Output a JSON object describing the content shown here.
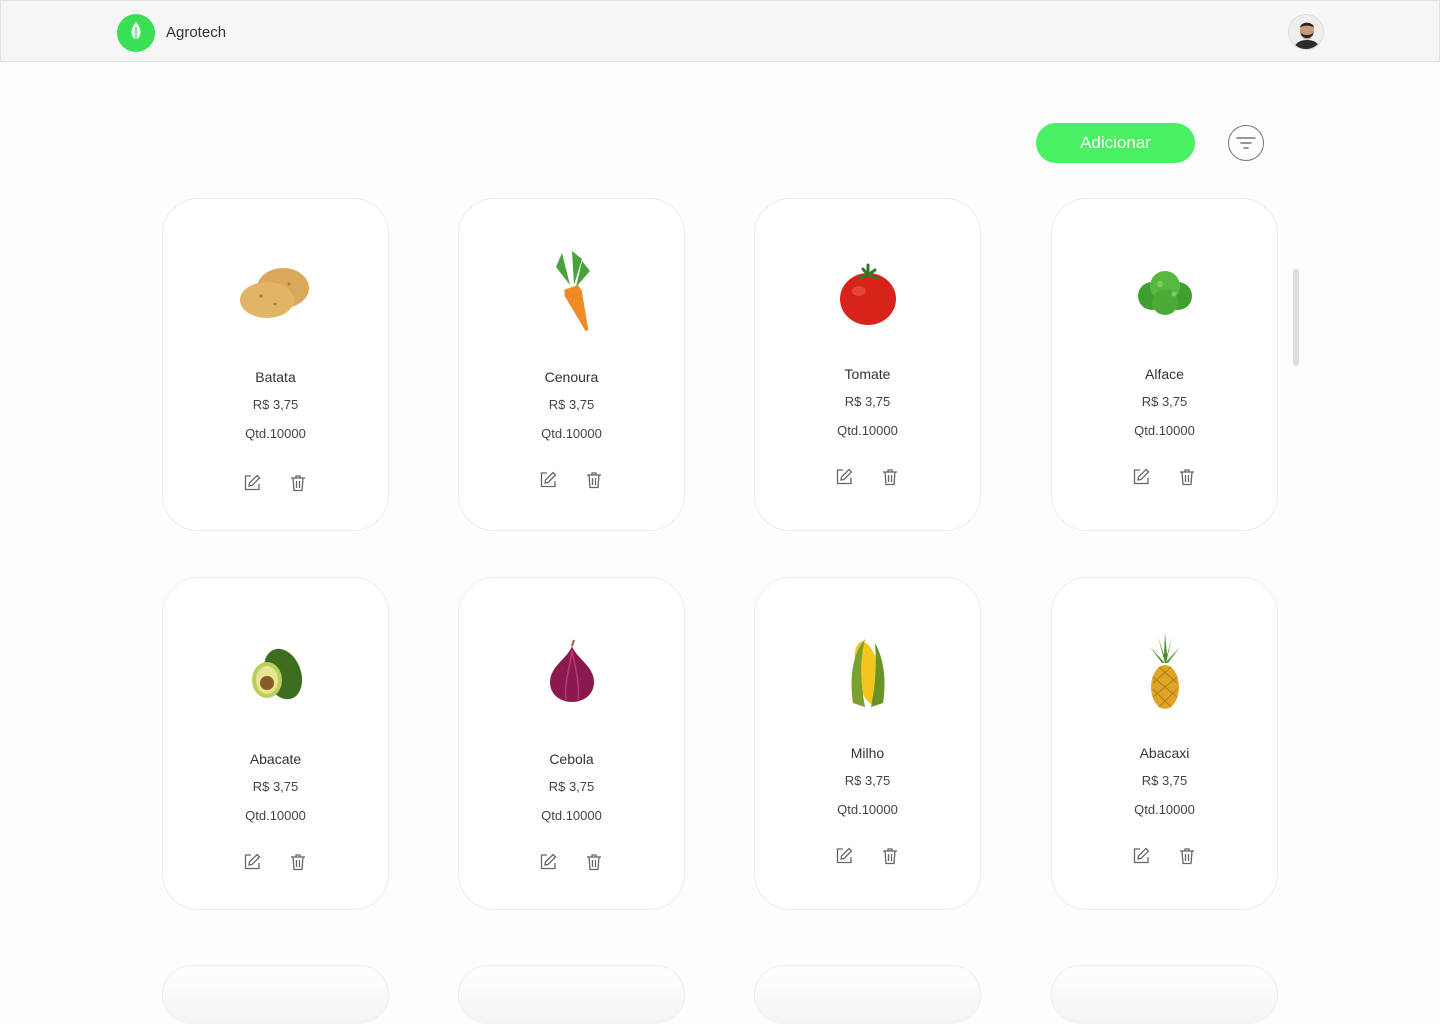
{
  "header": {
    "brand": "Agrotech",
    "logo_icon": "leaf-icon",
    "avatar": "user-avatar"
  },
  "toolbar": {
    "add_label": "Adicionar",
    "filter_icon": "filter-icon"
  },
  "colors": {
    "accent": "#48f062",
    "logo": "#3ae054"
  },
  "products": [
    {
      "name": "Batata",
      "price": "R$ 3,75",
      "qty": "Qtd.10000",
      "icon": "potato-icon"
    },
    {
      "name": "Cenoura",
      "price": "R$ 3,75",
      "qty": "Qtd.10000",
      "icon": "carrot-icon"
    },
    {
      "name": "Tomate",
      "price": "R$ 3,75",
      "qty": "Qtd.10000",
      "icon": "tomato-icon"
    },
    {
      "name": "Alface",
      "price": "R$ 3,75",
      "qty": "Qtd.10000",
      "icon": "lettuce-icon"
    },
    {
      "name": "Abacate",
      "price": "R$ 3,75",
      "qty": "Qtd.10000",
      "icon": "avocado-icon"
    },
    {
      "name": "Cebola",
      "price": "R$ 3,75",
      "qty": "Qtd.10000",
      "icon": "onion-icon"
    },
    {
      "name": "Milho",
      "price": "R$ 3,75",
      "qty": "Qtd.10000",
      "icon": "corn-icon"
    },
    {
      "name": "Abacaxi",
      "price": "R$ 3,75",
      "qty": "Qtd.10000",
      "icon": "pineapple-icon"
    }
  ]
}
